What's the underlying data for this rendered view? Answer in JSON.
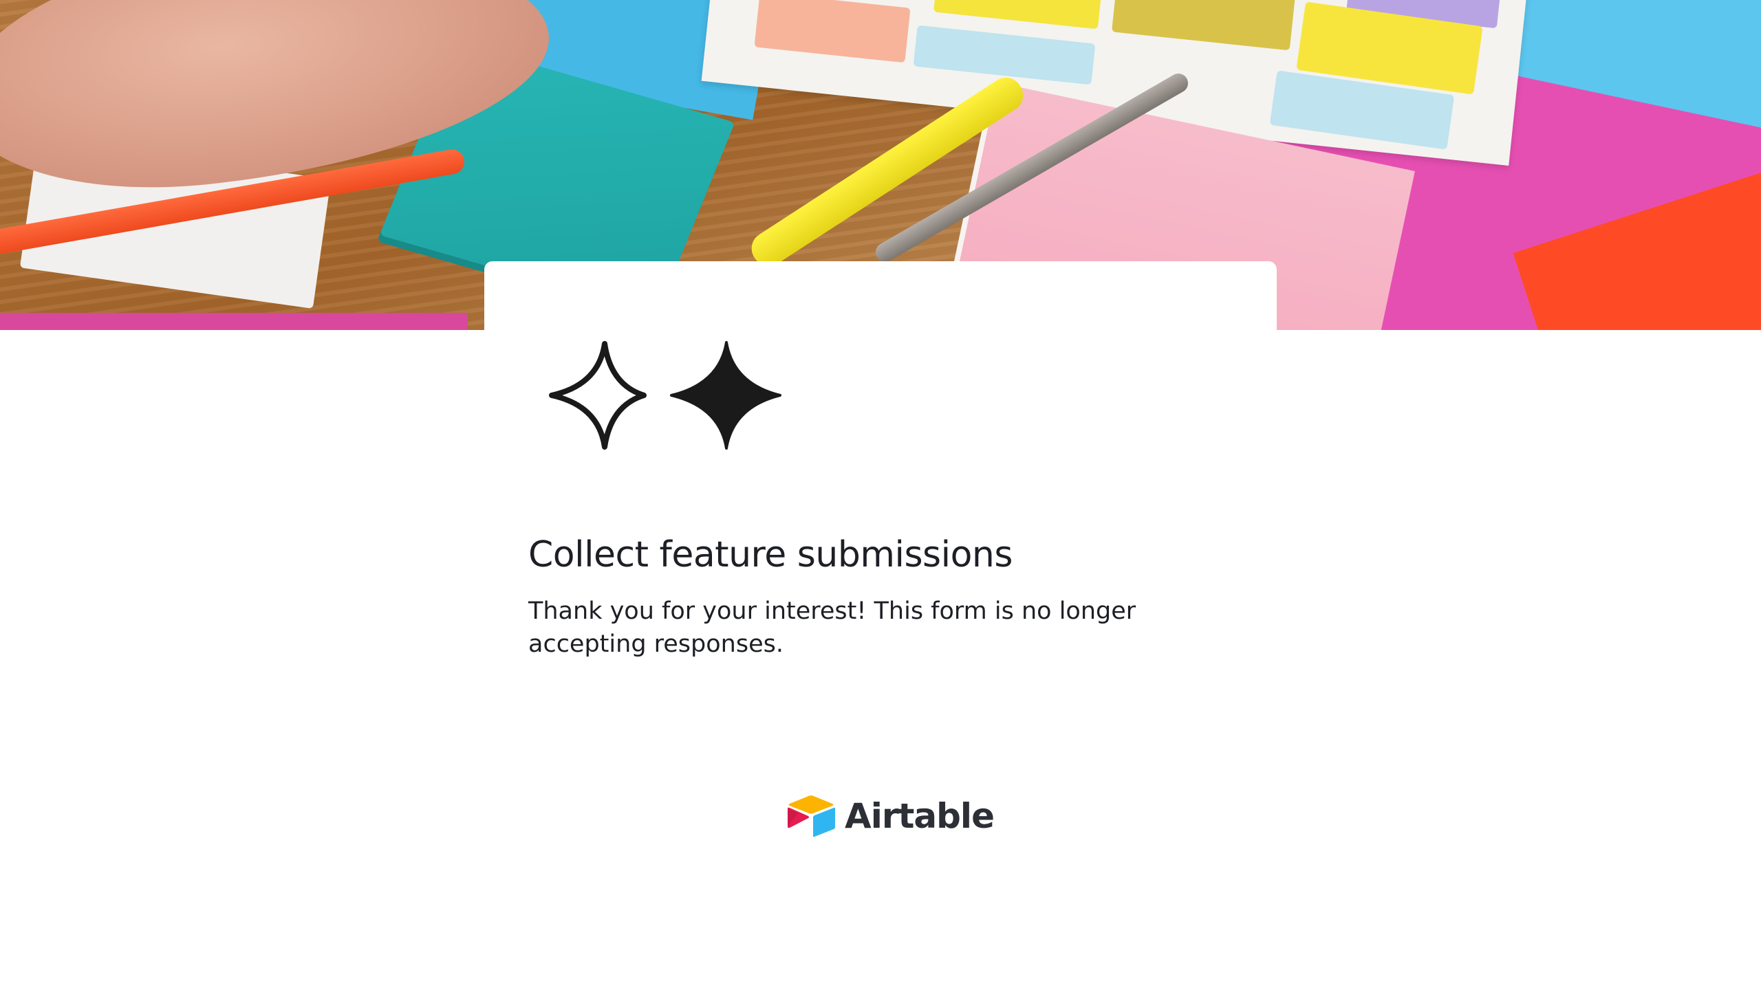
{
  "form": {
    "title": "Collect feature submissions",
    "message": "Thank you for your interest! This form is no longer accepting responses."
  },
  "branding": {
    "name": "Airtable",
    "logo_icon": "airtable-logo-icon",
    "logo_colors": {
      "top": "#fcb400",
      "left": "#e41c4f",
      "right": "#2fb6f0"
    }
  },
  "icons": {
    "outline_sparkle": "sparkle-outline-icon",
    "filled_sparkle": "sparkle-filled-icon"
  },
  "colors": {
    "page_background": "#ffffff",
    "text_primary": "#1d1f25",
    "brand_text": "#2d2f36"
  }
}
